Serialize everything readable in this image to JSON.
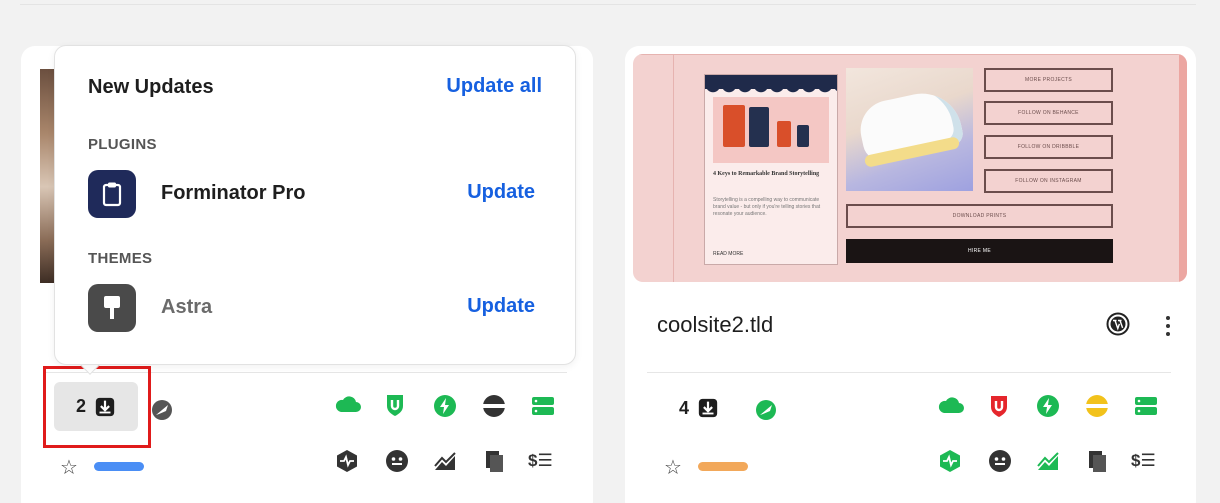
{
  "popup": {
    "title": "New Updates",
    "update_all_label": "Update all",
    "plugins_label": "PLUGINS",
    "themes_label": "THEMES",
    "plugins": [
      {
        "name": "Forminator Pro",
        "action": "Update",
        "icon": "clipboard-icon",
        "color": "#1f2a5a"
      }
    ],
    "themes": [
      {
        "name": "Astra",
        "action": "Update",
        "icon": "paint-roller-icon",
        "color": "#4a4a4a"
      }
    ]
  },
  "left_card": {
    "updates_count": "2",
    "pill_color": "#4a8ef5"
  },
  "right_card": {
    "site_name": "coolsite2.tld",
    "updates_count": "4",
    "pill_color": "#f2a85a",
    "preview": {
      "headline": "4 Keys to Remarkable Brand Storytelling",
      "body": "Storytelling is a compelling way to communicate brand value - but only if you're telling stories that resonate your audience.",
      "read_more": "READ MORE",
      "buttons": [
        "MORE PROJECTS",
        "FOLLOW ON BEHANCE",
        "FOLLOW ON DRIBBBLE",
        "FOLLOW ON INSTAGRAM"
      ],
      "download_prints": "DOWNLOAD PRINTS",
      "hire_me": "HIRE ME"
    }
  },
  "dollar_symbol": "$☰",
  "colors": {
    "accent_blue": "#1660e0",
    "green": "#1db954",
    "red": "#e5262c",
    "yellow": "#f2c21b",
    "highlight_red": "#e01b1b"
  }
}
